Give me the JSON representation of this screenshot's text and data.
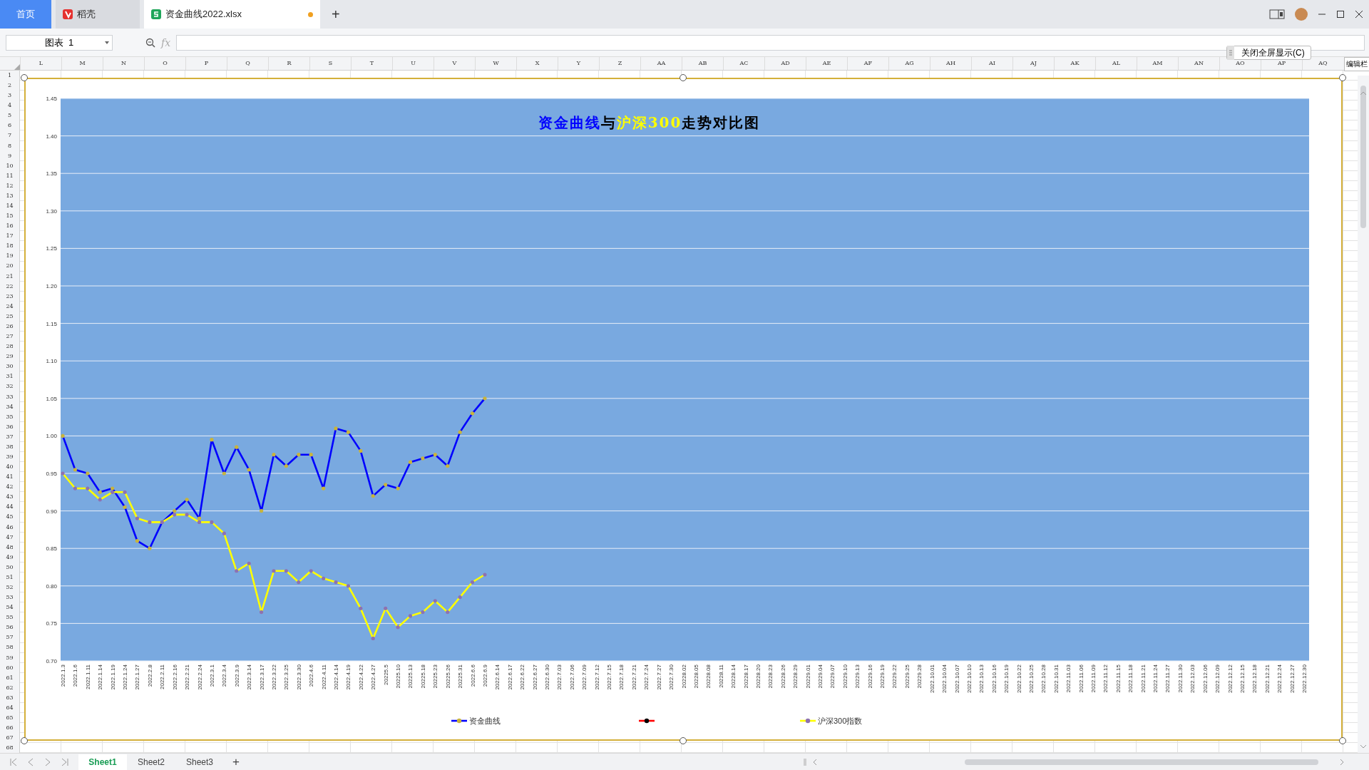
{
  "title_bar": {
    "tabs": [
      {
        "kind": "home",
        "label": "首页",
        "selected": false
      },
      {
        "kind": "docer",
        "label": "稻壳",
        "selected": false
      },
      {
        "kind": "workbook",
        "label": "资金曲线2022.xlsx",
        "selected": true,
        "unsaved": true
      }
    ],
    "new_tab": "+"
  },
  "formula_bar": {
    "name_box": "图表  1",
    "fx": "fx"
  },
  "fullscreen_popup": {
    "close_fullscreen": "关闭全屏显示(C)",
    "edit_bar": "编辑栏"
  },
  "sheet": {
    "columns": [
      "L",
      "M",
      "N",
      "O",
      "P",
      "Q",
      "R",
      "S",
      "T",
      "U",
      "V",
      "W",
      "X",
      "Y",
      "Z",
      "AA",
      "AB",
      "AC",
      "AD",
      "AE",
      "AF",
      "AG",
      "AH",
      "AI",
      "AJ",
      "AK",
      "AL",
      "AM",
      "AN",
      "AO",
      "AP",
      "AQ"
    ],
    "rows": [
      "1",
      "2",
      "3",
      "4",
      "5",
      "6",
      "7",
      "8",
      "9",
      "10",
      "11",
      "12",
      "13",
      "14",
      "15",
      "16",
      "17",
      "18",
      "19",
      "20",
      "21",
      "22",
      "23",
      "24",
      "25",
      "26",
      "27",
      "28",
      "29",
      "30",
      "31",
      "32",
      "33",
      "34",
      "35",
      "36",
      "37",
      "38",
      "39",
      "40",
      "41",
      "42",
      "43",
      "44",
      "45",
      "46",
      "47",
      "48",
      "49",
      "50",
      "51",
      "52",
      "53",
      "54",
      "55",
      "56",
      "57",
      "58",
      "59",
      "60",
      "61",
      "62",
      "63",
      "64",
      "65",
      "66",
      "67",
      "68"
    ]
  },
  "chart": {
    "title_parts": [
      {
        "text": "资金曲线",
        "color": "#0000ff"
      },
      {
        "text": "与",
        "color": "#000000"
      },
      {
        "text": "沪深300",
        "color": "#ffff00"
      },
      {
        "text": "走势对比图",
        "color": "#000000"
      }
    ],
    "markers": [
      {
        "color": "#c8b43c"
      },
      {
        "color": "#000000"
      },
      {
        "color": "#8e72b0"
      }
    ],
    "chart_data": {
      "type": "line",
      "grid": true,
      "legend": true,
      "categories": [
        "2022.1.3",
        "2022.1.6",
        "2022.1.11",
        "2022.1.14",
        "2022.1.19",
        "2022.1.24",
        "2022.1.27",
        "2022.2.8",
        "2022.2.11",
        "2022.2.16",
        "2022.2.21",
        "2022.2.24",
        "2022.3.1",
        "2022.3.4",
        "2022.3.9",
        "2022.3.14",
        "2022.3.17",
        "2022.3.22",
        "2022.3.25",
        "2022.3.30",
        "2022.4.6",
        "2022.4.11",
        "2022.4.14",
        "2022.4.19",
        "2022.4.22",
        "2022.4.27",
        "20225.5",
        "20225.10",
        "20225.13",
        "20225.18",
        "20225.23",
        "20225.26",
        "20225.31",
        "2022.6.6",
        "2022.6.9",
        "2022.6.14",
        "2022.6.17",
        "2022.6.22",
        "2022.6.27",
        "2022.6.30",
        "2022.7.03",
        "2022.7.06",
        "2022.7.09",
        "2022.7.12",
        "2022.7.15",
        "2022.7.18",
        "2022.7.21",
        "2022.7.24",
        "2022.7.27",
        "2022.7.30",
        "20228.02",
        "20228.05",
        "20228.08",
        "20228.11",
        "20228.14",
        "20228.17",
        "20228.20",
        "20228.23",
        "20228.26",
        "20228.29",
        "20229.01",
        "20229.04",
        "20229.07",
        "20229.10",
        "20229.13",
        "20229.16",
        "20229.19",
        "20229.22",
        "20229.25",
        "20229.28",
        "2022.10.01",
        "2022.10.04",
        "2022.10.07",
        "2022.10.10",
        "2022.10.13",
        "2022.10.16",
        "2022.10.19",
        "2022.10.22",
        "2022.10.25",
        "2022.10.28",
        "2022.10.31",
        "2022.11.03",
        "2022.11.06",
        "2022.11.09",
        "2022.11.12",
        "2022.11.15",
        "2022.11.18",
        "2022.11.21",
        "2022.11.24",
        "2022.11.27",
        "2022.11.30",
        "2022.12.03",
        "2022.12.06",
        "2022.12.09",
        "2022.12.12",
        "2022.12.15",
        "2022.12.18",
        "2022.12.21",
        "2022.12.24",
        "2022.12.27",
        "2022.12.30"
      ],
      "ylim": [
        0.7,
        1.45
      ],
      "yticks": [
        {
          "value": 0.7,
          "label": "0.70"
        },
        {
          "value": 0.75,
          "label": "0.75"
        },
        {
          "value": 0.8,
          "label": "0.80"
        },
        {
          "value": 0.85,
          "label": "0.85"
        },
        {
          "value": 0.9,
          "label": "0.90"
        },
        {
          "value": 0.95,
          "label": "0.95"
        },
        {
          "value": 1.0,
          "label": "1.00"
        },
        {
          "value": 1.05,
          "label": "1.05"
        },
        {
          "value": 1.1,
          "label": "1.10"
        },
        {
          "value": 1.15,
          "label": "1.15"
        },
        {
          "value": 1.2,
          "label": "1.20"
        },
        {
          "value": 1.25,
          "label": "1.25"
        },
        {
          "value": 1.3,
          "label": "1.30"
        },
        {
          "value": 1.35,
          "label": "1.35"
        },
        {
          "value": 1.4,
          "label": "1.40"
        },
        {
          "value": 1.45,
          "label": "1.45"
        }
      ],
      "series": [
        {
          "name": "资金曲线",
          "color": "#0000ff",
          "values": [
            1.0,
            0.955,
            0.95,
            0.925,
            0.93,
            0.905,
            0.86,
            0.85,
            0.885,
            0.9,
            0.915,
            0.89,
            0.995,
            0.95,
            0.985,
            0.955,
            0.9,
            0.975,
            0.96,
            0.975,
            0.975,
            0.93,
            1.01,
            1.005,
            0.98,
            0.92,
            0.935,
            0.93,
            0.965,
            0.97,
            0.975,
            0.96,
            1.005,
            1.03,
            1.05,
            null,
            null,
            null,
            null,
            null,
            null,
            null,
            null,
            null,
            null,
            null,
            null,
            null,
            null,
            null,
            null,
            null,
            null,
            null,
            null,
            null,
            null,
            null,
            null,
            null,
            null,
            null,
            null,
            null,
            null,
            null,
            null,
            null,
            null,
            null,
            null,
            null,
            null,
            null,
            null,
            null,
            null,
            null,
            null,
            null,
            null,
            null,
            null,
            null,
            null,
            null,
            null,
            null,
            null,
            null,
            null,
            null,
            null,
            null,
            null,
            null,
            null,
            null,
            null,
            null,
            null
          ]
        },
        {
          "color": "#ff0000",
          "values": [
            null,
            null,
            null,
            null,
            null,
            null,
            null,
            null,
            null,
            null,
            null,
            null,
            null,
            null,
            null,
            null,
            null,
            null,
            null,
            null,
            null,
            null,
            null,
            null,
            null,
            null,
            null,
            null,
            null,
            null,
            null,
            null,
            null,
            null,
            null,
            null,
            null,
            null,
            null,
            null,
            null,
            null,
            null,
            null,
            null,
            null,
            null,
            null,
            null,
            null,
            null,
            null,
            null,
            null,
            null,
            null,
            null,
            null,
            null,
            null,
            null,
            null,
            null,
            null,
            null,
            null,
            null,
            null,
            null,
            null,
            null,
            null,
            null,
            null,
            null,
            null,
            null,
            null,
            null,
            null,
            null,
            null,
            null,
            null,
            null,
            null,
            null,
            null,
            null,
            null,
            null,
            null,
            null,
            null,
            null,
            null,
            null,
            null,
            null,
            null,
            null
          ]
        },
        {
          "name": "沪深300指数",
          "color": "#ffff00",
          "values": [
            0.95,
            0.93,
            0.93,
            0.915,
            0.925,
            0.925,
            0.89,
            0.885,
            0.885,
            0.895,
            0.895,
            0.885,
            0.885,
            0.87,
            0.82,
            0.83,
            0.765,
            0.82,
            0.82,
            0.805,
            0.82,
            0.81,
            0.805,
            0.8,
            0.77,
            0.73,
            0.77,
            0.745,
            0.76,
            0.765,
            0.78,
            0.765,
            0.785,
            0.805,
            0.815,
            null,
            null,
            null,
            null,
            null,
            null,
            null,
            null,
            null,
            null,
            null,
            null,
            null,
            null,
            null,
            null,
            null,
            null,
            null,
            null,
            null,
            null,
            null,
            null,
            null,
            null,
            null,
            null,
            null,
            null,
            null,
            null,
            null,
            null,
            null,
            null,
            null,
            null,
            null,
            null,
            null,
            null,
            null,
            null,
            null,
            null,
            null,
            null,
            null,
            null,
            null,
            null,
            null,
            null,
            null,
            null,
            null,
            null,
            null,
            null,
            null,
            null,
            null,
            null,
            null,
            null
          ]
        }
      ]
    }
  },
  "sheet_tabs": {
    "tabs": [
      {
        "label": "Sheet1",
        "selected": true
      },
      {
        "label": "Sheet2",
        "selected": false
      },
      {
        "label": "Sheet3",
        "selected": false
      }
    ],
    "add": "+"
  }
}
